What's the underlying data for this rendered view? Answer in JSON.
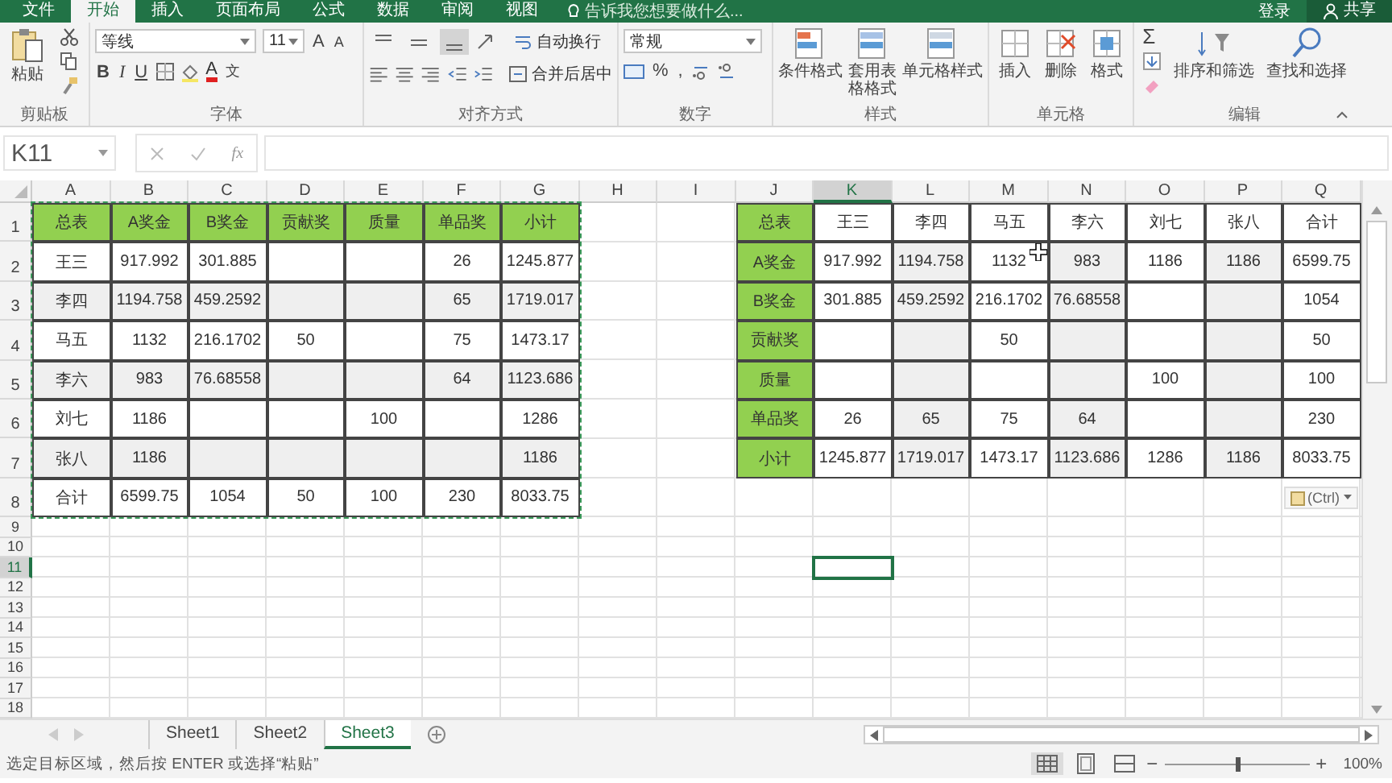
{
  "ribbon_tabs": [
    {
      "label": "文件",
      "selected": false
    },
    {
      "label": "开始",
      "selected": true
    },
    {
      "label": "插入",
      "selected": false
    },
    {
      "label": "页面布局",
      "selected": false
    },
    {
      "label": "公式",
      "selected": false
    },
    {
      "label": "数据",
      "selected": false
    },
    {
      "label": "审阅",
      "selected": false
    },
    {
      "label": "视图",
      "selected": false
    }
  ],
  "tell_me": "告诉我您想要做什么...",
  "sign_in": "登录",
  "share": "共享",
  "clipboard": {
    "label": "剪贴板",
    "paste": "粘贴"
  },
  "font": {
    "label": "字体",
    "family": "等线",
    "size": "11",
    "grow": "A",
    "shrink": "A",
    "bold": "B",
    "italic": "I",
    "underline": "U",
    "font_color_button": "A",
    "phonetic": "文"
  },
  "alignment": {
    "label": "对齐方式",
    "vertical": [
      {
        "selected": false
      },
      {
        "selected": false
      },
      {
        "selected": true
      }
    ],
    "wrap": "自动换行",
    "merge": "合并后居中"
  },
  "number": {
    "label": "数字",
    "format": "常规",
    "percent": "%",
    "comma": ","
  },
  "styles": {
    "label": "样式",
    "buttons": [
      "条件格式",
      "套用表格格式",
      "单元格样式"
    ]
  },
  "cells": {
    "label": "单元格",
    "buttons": [
      "插入",
      "删除",
      "格式"
    ]
  },
  "editing": {
    "label": "编辑",
    "sum": "Σ",
    "buttons": [
      "排序和筛选",
      "查找和选择"
    ]
  },
  "formula_bar": {
    "name_box": "K11",
    "fx": "fx"
  },
  "columns": [
    {
      "label": "A",
      "selected": false
    },
    {
      "label": "B",
      "selected": false
    },
    {
      "label": "C",
      "selected": false
    },
    {
      "label": "D",
      "selected": false
    },
    {
      "label": "E",
      "selected": false
    },
    {
      "label": "F",
      "selected": false
    },
    {
      "label": "G",
      "selected": false
    },
    {
      "label": "H",
      "selected": false
    },
    {
      "label": "I",
      "selected": false
    },
    {
      "label": "J",
      "selected": false
    },
    {
      "label": "K",
      "selected": true
    },
    {
      "label": "L",
      "selected": false
    },
    {
      "label": "M",
      "selected": false
    },
    {
      "label": "N",
      "selected": false
    },
    {
      "label": "O",
      "selected": false
    },
    {
      "label": "P",
      "selected": false
    },
    {
      "label": "Q",
      "selected": false
    }
  ],
  "rows": [
    {
      "label": "1",
      "selected": false
    },
    {
      "label": "2",
      "selected": false
    },
    {
      "label": "3",
      "selected": false
    },
    {
      "label": "4",
      "selected": false
    },
    {
      "label": "5",
      "selected": false
    },
    {
      "label": "6",
      "selected": false
    },
    {
      "label": "7",
      "selected": false
    },
    {
      "label": "8",
      "selected": false
    },
    {
      "label": "9",
      "selected": false
    },
    {
      "label": "10",
      "selected": false
    },
    {
      "label": "11",
      "selected": true
    },
    {
      "label": "12",
      "selected": false
    },
    {
      "label": "13",
      "selected": false
    },
    {
      "label": "14",
      "selected": false
    },
    {
      "label": "15",
      "selected": false
    },
    {
      "label": "16",
      "selected": false
    },
    {
      "label": "17",
      "selected": false
    },
    {
      "label": "18",
      "selected": false
    }
  ],
  "left_table": [
    {
      "A": "总表",
      "B": "A奖金",
      "C": "B奖金",
      "D": "贡献奖",
      "E": "质量",
      "F": "单品奖",
      "G": "小计"
    },
    {
      "A": "王三",
      "B": "917.992",
      "C": "301.885",
      "F": "26",
      "G": "1245.877"
    },
    {
      "A": "李四",
      "B": "1194.758",
      "C": "459.2592",
      "F": "65",
      "G": "1719.017"
    },
    {
      "A": "马五",
      "B": "1132",
      "C": "216.1702",
      "D": "50",
      "F": "75",
      "G": "1473.17"
    },
    {
      "A": "李六",
      "B": "983",
      "C": "76.68558",
      "F": "64",
      "G": "1123.686"
    },
    {
      "A": "刘七",
      "B": "1186",
      "E": "100",
      "G": "1286"
    },
    {
      "A": "张八",
      "B": "1186",
      "G": "1186"
    },
    {
      "A": "合计",
      "B": "6599.75",
      "C": "1054",
      "D": "50",
      "E": "100",
      "F": "230",
      "G": "8033.75"
    }
  ],
  "right_table": [
    {
      "J": "总表",
      "K": "王三",
      "L": "李四",
      "M": "马五",
      "N": "李六",
      "O": "刘七",
      "P": "张八",
      "Q": "合计"
    },
    {
      "J": "A奖金",
      "K": "917.992",
      "L": "1194.758",
      "M": "1132",
      "N": "983",
      "O": "1186",
      "P": "1186",
      "Q": "6599.75"
    },
    {
      "J": "B奖金",
      "K": "301.885",
      "L": "459.2592",
      "M": "216.1702",
      "N": "76.68558",
      "Q": "1054"
    },
    {
      "J": "贡献奖",
      "M": "50",
      "Q": "50"
    },
    {
      "J": "质量",
      "O": "100",
      "Q": "100"
    },
    {
      "J": "单品奖",
      "K": "26",
      "L": "65",
      "M": "75",
      "N": "64",
      "Q": "230"
    },
    {
      "J": "小计",
      "K": "1245.877",
      "L": "1719.017",
      "M": "1473.17",
      "N": "1123.686",
      "O": "1286",
      "P": "1186",
      "Q": "8033.75"
    }
  ],
  "paste_options": "(Ctrl)",
  "sheet_tabs": [
    {
      "label": "Sheet1",
      "selected": false
    },
    {
      "label": "Sheet2",
      "selected": false
    },
    {
      "label": "Sheet3",
      "selected": true
    }
  ],
  "status": "选定目标区域，然后按 ENTER 或选择“粘贴”",
  "zoom": {
    "zoom_out": "−",
    "level": 0.5,
    "zoom_in": "+",
    "reading": "100%"
  }
}
